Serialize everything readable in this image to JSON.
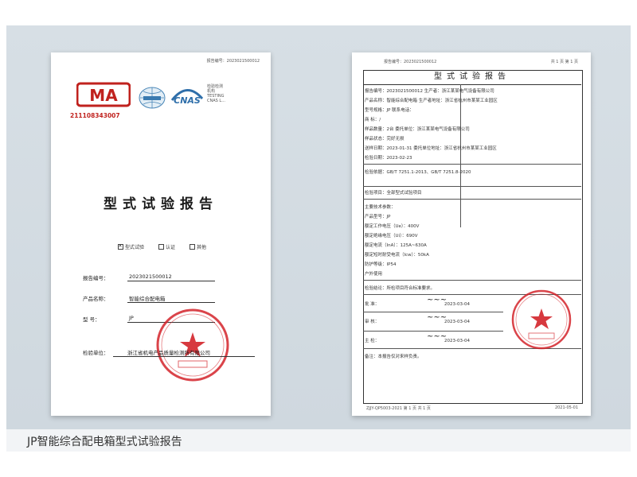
{
  "caption": "JP智能综合配电箱型式试验报告",
  "left_page": {
    "top_line": "报告编号：2023021500012",
    "cma_number": "211108343007",
    "cnas_lines": [
      "检验检测",
      "机构",
      "TESTING",
      "CNAS L..."
    ],
    "title": "型式试验报告",
    "check_options": [
      {
        "label": "型式试验",
        "checked": true
      },
      {
        "label": "认证",
        "checked": false
      },
      {
        "label": "其他",
        "checked": false
      }
    ],
    "fields": [
      {
        "label": "报告编号：",
        "value": "2023021500012"
      },
      {
        "label": "产品名称：",
        "value": "智能综合配电箱"
      },
      {
        "label": "型    号：",
        "value": "JP"
      }
    ],
    "unit_label": "检验单位：",
    "unit_value": "浙江省机电产品质量检测所有限公司"
  },
  "right_page": {
    "top_left": "报告编号：2023021500012",
    "top_right": "共 1 页 第 1 页",
    "title": "型式试验报告",
    "rows": [
      "报告编号：2023021500012          生产者：浙江某某电气设备有限公司",
      "产品名称：智能综合配电箱          生产者地址：浙江省杭州市某某工业园区",
      "型号规格：JP                      联系电话：",
      "商    标：/",
      "样品数量：2台                      委托单位：浙江某某电气设备有限公司",
      "样品状态：完好无损",
      "送样日期：2023-01-31              委托单位地址：浙江省杭州市某某工业园区",
      "检验日期：2023-02-23",
      "检验依据：GB/T 7251.1-2013、GB/T 7251.8-2020",
      "检验项目：全部型式试验项目",
      "主要技术参数：",
      "产品型号：JP",
      "额定工作电压（Ue）：400V",
      "额定绝缘电压（Ui）：690V",
      "额定电流（InA）：125A~630A",
      "额定短时耐受电流（Icw）：50kA",
      "防护等级：IP54",
      "户外使用",
      "检验结论：所检项目符合标准要求。"
    ],
    "sign_rows": [
      {
        "label": "批    准：",
        "date": "2023-03-04"
      },
      {
        "label": "审    核：",
        "date": "2023-03-04"
      },
      {
        "label": "主    检：",
        "date": "2023-03-04"
      }
    ],
    "remarks": "备注：本报告仅对来样负责。",
    "bottom_left": "ZJJY-QP5003-2021 第 1 页 共 1 页",
    "bottom_right": "2021-05-01"
  },
  "colors": {
    "seal": "#d3232a",
    "cma": "#c0221e",
    "backdrop": "#d3dbe2"
  }
}
